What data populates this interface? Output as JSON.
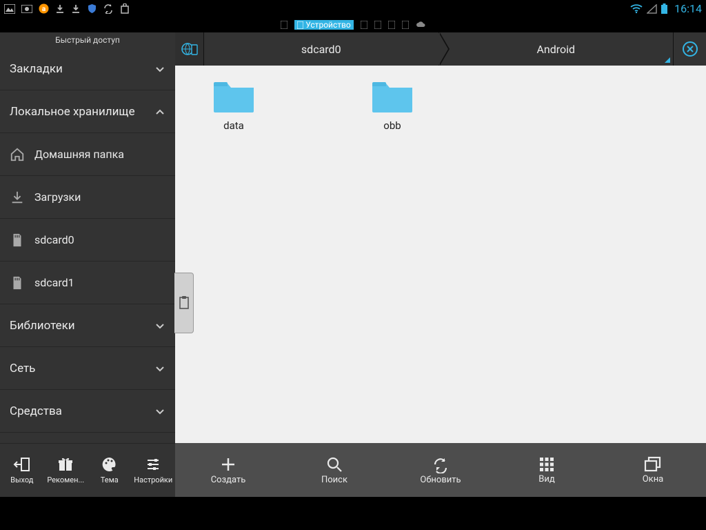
{
  "status": {
    "time": "16:14"
  },
  "tabs": {
    "active_label": "Устройство"
  },
  "sidebar": {
    "title": "Быстрый доступ",
    "sections": {
      "bookmarks": "Закладки",
      "local": "Локальное хранилище",
      "libraries": "Библиотеки",
      "network": "Сеть",
      "tools": "Средства"
    },
    "local_items": [
      {
        "label": "Домашняя папка"
      },
      {
        "label": "Загрузки"
      },
      {
        "label": "sdcard0"
      },
      {
        "label": "sdcard1"
      }
    ],
    "bottom": [
      {
        "label": "Выход"
      },
      {
        "label": "Рекомен..."
      },
      {
        "label": "Тема"
      },
      {
        "label": "Настройки"
      }
    ]
  },
  "breadcrumb": {
    "seg1": "sdcard0",
    "seg2": "Android"
  },
  "folders": [
    {
      "name": "data"
    },
    {
      "name": "obb"
    }
  ],
  "toolbar": [
    {
      "label": "Создать"
    },
    {
      "label": "Поиск"
    },
    {
      "label": "Обновить"
    },
    {
      "label": "Вид"
    },
    {
      "label": "Окна"
    }
  ],
  "colors": {
    "accent": "#33b5e5"
  }
}
